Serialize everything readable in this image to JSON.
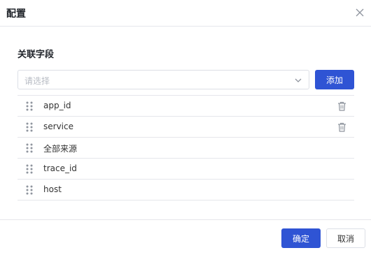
{
  "dialog": {
    "title": "配置",
    "close_icon": "close-icon"
  },
  "section": {
    "label": "关联字段"
  },
  "select": {
    "placeholder": "请选择",
    "icon": "chevron-down-icon"
  },
  "add_button": {
    "label": "添加"
  },
  "fields": [
    {
      "label": "app_id",
      "deletable": true
    },
    {
      "label": "service",
      "deletable": true
    },
    {
      "label": "全部来源",
      "deletable": false
    },
    {
      "label": "trace_id",
      "deletable": false
    },
    {
      "label": "host",
      "deletable": false
    }
  ],
  "footer": {
    "confirm_label": "确定",
    "cancel_label": "取消"
  },
  "colors": {
    "primary": "#2f54d4",
    "border": "#e5e6eb",
    "placeholder": "#b8bcc4"
  }
}
